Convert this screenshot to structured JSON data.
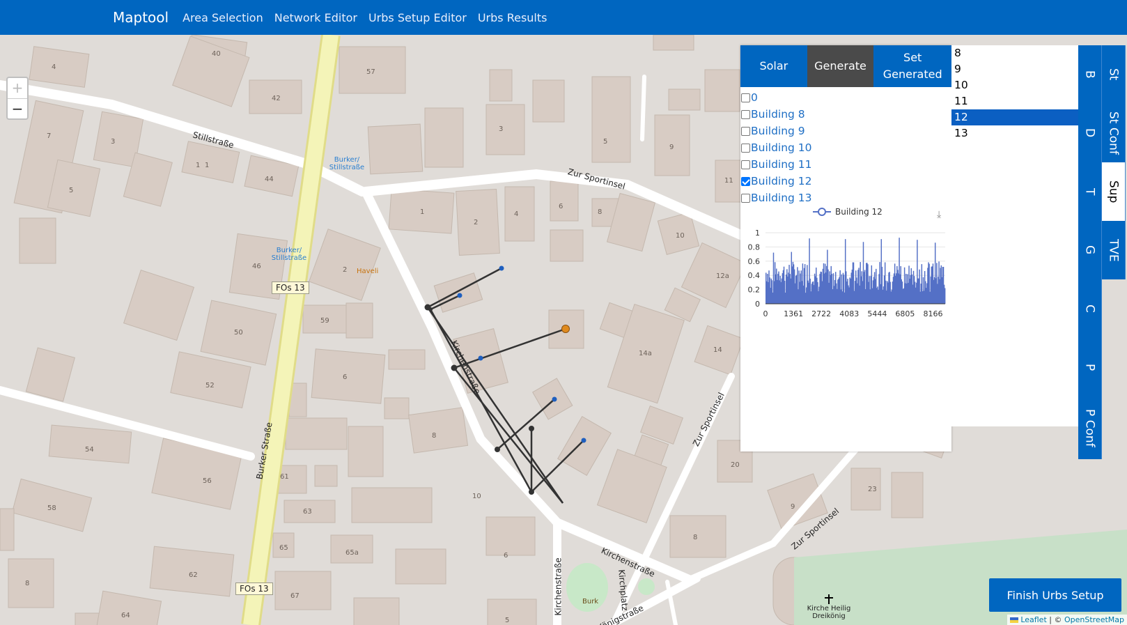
{
  "navbar": {
    "brand": "Maptool",
    "links": [
      "Area Selection",
      "Network Editor",
      "Urbs Setup Editor",
      "Urbs Results"
    ]
  },
  "zoom": {
    "in": "+",
    "out": "−"
  },
  "tabs": [
    "Solar",
    "Generate",
    "Set Generated"
  ],
  "active_tab": "Generate",
  "buildings": [
    {
      "label": "0",
      "checked": false
    },
    {
      "label": "Building 8",
      "checked": false
    },
    {
      "label": "Building 9",
      "checked": false
    },
    {
      "label": "Building 10",
      "checked": false
    },
    {
      "label": "Building 11",
      "checked": false
    },
    {
      "label": "Building 12",
      "checked": true
    },
    {
      "label": "Building 13",
      "checked": false
    }
  ],
  "legend": "Building 12",
  "chart_data": {
    "type": "bar",
    "series": [
      {
        "name": "Building 12",
        "color": "#5470c6"
      }
    ],
    "x_ticks": [
      0,
      1361,
      2722,
      4083,
      5444,
      6805,
      8166
    ],
    "y_ticks": [
      0,
      0.2,
      0.4,
      0.6,
      0.8,
      1
    ],
    "xlim": [
      0,
      8760
    ],
    "ylim": [
      0,
      1
    ],
    "grid": true,
    "peaks": [
      0.72,
      0.73,
      0.92,
      0.76,
      0.91,
      0.87,
      0.91,
      0.93,
      0.9,
      0.86
    ]
  },
  "list_items": [
    "8",
    "9",
    "10",
    "11",
    "12",
    "13"
  ],
  "list_selected": "12",
  "vtabs_right": [
    "St",
    "St Conf",
    "Sup",
    "TVE"
  ],
  "vtabs_right_active": "Sup",
  "vtabs_left": [
    "B",
    "D",
    "T",
    "G",
    "C",
    "P",
    "P Conf"
  ],
  "finish_button": "Finish Urbs Setup",
  "attribution": {
    "leaflet": "Leaflet",
    "sep": " | © ",
    "osm": "OpenStreetMap"
  },
  "map_labels": {
    "streets": [
      "Stillstraße",
      "Zur Sportinsel",
      "Kirchenstraße",
      "Burker Straße",
      "Zur Sportinsel",
      "Zur Sportinsel",
      "Kirchplatz",
      "Kirchenstraße",
      "Kirchenstraße",
      "Königstraße"
    ],
    "bus_stops": [
      "Burker/ Stillstraße",
      "Burker/ Stillstraße"
    ],
    "route_labels": [
      "FOs 13",
      "FOs 13"
    ],
    "poi": [
      "Haveli",
      "Burk",
      "Kirche Heilig Dreikönig"
    ],
    "house_numbers": [
      "40",
      "4",
      "57",
      "42",
      "7",
      "3",
      "1",
      "44",
      "5",
      "1",
      "3",
      "5",
      "9",
      "11",
      "1",
      "2",
      "4",
      "6",
      "8",
      "10",
      "12a",
      "46",
      "2",
      "50",
      "59",
      "6",
      "14a",
      "14",
      "52",
      "8",
      "54",
      "56",
      "61",
      "20",
      "58",
      "63",
      "10",
      "23",
      "9",
      "65",
      "65a",
      "6",
      "8",
      "62",
      "67",
      "64",
      "5",
      "8"
    ]
  }
}
